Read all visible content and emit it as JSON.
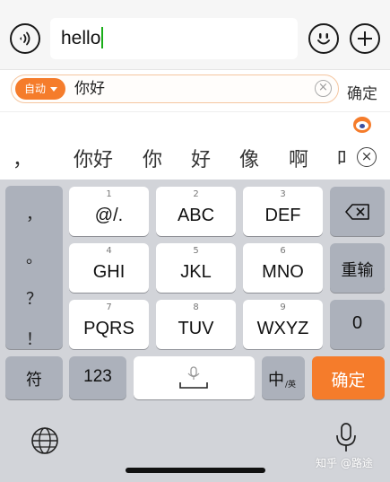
{
  "compose": {
    "input_value": "hello",
    "voice_icon": "voice-wave-icon",
    "emoji_icon": "smiley-icon",
    "plus_icon": "plus-icon"
  },
  "ime": {
    "mode_badge": "自动",
    "composition": "你好",
    "confirm_label": "确定",
    "candidates": [
      "，",
      "你好",
      "你",
      "好",
      "像",
      "啊",
      "叩"
    ],
    "close_symbol": "⊗"
  },
  "keyboard": {
    "punctuation": [
      "，",
      "。",
      "？",
      "！"
    ],
    "keys": [
      {
        "num": "1",
        "label": "@/."
      },
      {
        "num": "2",
        "label": "ABC"
      },
      {
        "num": "3",
        "label": "DEF"
      },
      {
        "num": "4",
        "label": "GHI"
      },
      {
        "num": "5",
        "label": "JKL"
      },
      {
        "num": "6",
        "label": "MNO"
      },
      {
        "num": "7",
        "label": "PQRS"
      },
      {
        "num": "8",
        "label": "TUV"
      },
      {
        "num": "9",
        "label": "WXYZ"
      }
    ],
    "delete_icon": "backspace-icon",
    "retype_label": "重输",
    "zero_label": "0",
    "symbol_label": "符",
    "numbers_label": "123",
    "space_icon": "mic-space-icon",
    "lang_main": "中",
    "lang_sub": "/英",
    "confirm_label": "确定",
    "globe_icon": "globe-icon",
    "mic_icon": "microphone-icon"
  },
  "watermark": "知乎 @路途",
  "colors": {
    "accent": "#f57c2b",
    "keyboard_bg": "#d2d4d9",
    "function_key": "#acb1bb",
    "caret": "#1aad19"
  }
}
